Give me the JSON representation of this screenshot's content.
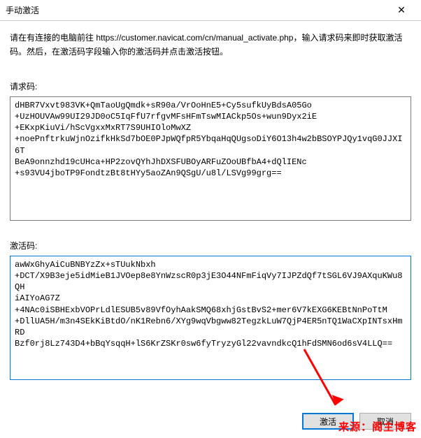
{
  "window": {
    "title": "手动激活",
    "close_label": "✕"
  },
  "instruction": "请在有连接的电脑前往 https://customer.navicat.com/cn/manual_activate.php，输入请求码来即时获取激活码。然后，在激活码字段输入你的激活码并点击激活按钮。",
  "labels": {
    "request_code": "请求码:",
    "activation_code": "激活码:"
  },
  "request_code": "dHBR7Vxvt983VK+QmTaoUgQmdk+sR90a/VrOoHnE5+Cy5sufkUyBdsA05Go\n+UzHOUVAw99UI29JD0oC5IqFfU7rfgvMFsHFmTswMIACkp5Os+wun9Dyx2iE\n+EKxpKiuVi/hScVgxxMxRT7S9UHIOloMwXZ\n+noePnftrkuWjnOzifkHkSd7bOE0PJpWQfpR5YbqaHqQUgsoDiY6O13h4w2bBSOYPJQy1vqG0JJXI6T\nBeA9onnzhd19cUHca+HP2zovQYhJhDXSFUBOyARFuZOoUBfbA4+dQlIENc\n+s93VU4jboTP9FondtzBt8tHYy5aoZAn9QSgU/u8l/LSVg99grg==",
  "activation_code": "awWxGhyAiCuBNBYzZx+sTUukNbxh\n+DCT/X9B3eje5idMieB1JVOep8e8YnWzscR0p3jE3O44NFmFiqVy7IJPZdQf7tSGL6VJ9AXquKWu8QH\niAIYoAG7Z\n+4NAc0iSBHExbVOPrLdlESUB5v89VfOyhAakSMQ68xhjGstBvS2+mer6V7kEXG6KEBtNnPoTtM\n+DllUA5H/m3n4SEkKiBtdO/nK1Rebn6/XYg9wqVbgww82TegzkLuW7QjP4ER5nTQ1WaCXpINTsxHmRD\nBzf0rj8Lz743D4+bBqYsqqH+lS6KrZSKr0sw6fyTryzyGl22vavndkcQ1hFdSMN6od6sV4LLQ==",
  "buttons": {
    "activate": "激活",
    "cancel": "取消"
  },
  "watermark": "来源：阁主博客"
}
